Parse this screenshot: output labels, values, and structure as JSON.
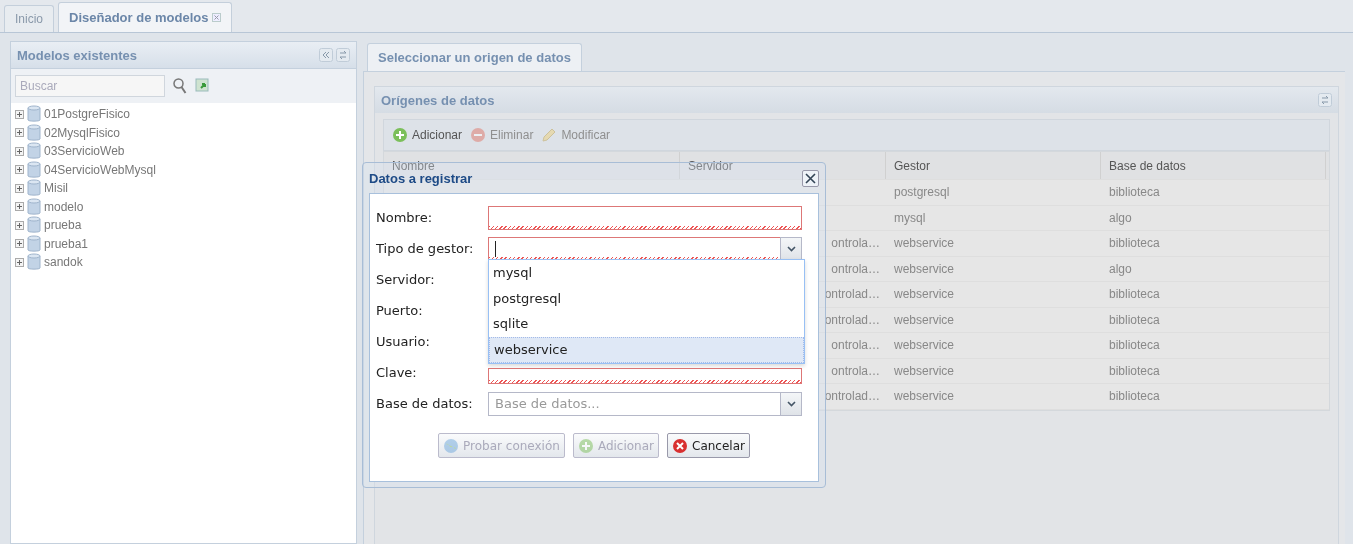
{
  "top_tabs": [
    {
      "label": "Inicio",
      "selected": false,
      "closable": false
    },
    {
      "label": "Diseñador de modelos",
      "selected": true,
      "closable": true
    }
  ],
  "left_panel": {
    "title": "Modelos existentes",
    "search": {
      "placeholder": "Buscar"
    },
    "tree": [
      {
        "label": "01PostgreFisico",
        "expanded": false
      },
      {
        "label": "02MysqlFisico",
        "expanded": false
      },
      {
        "label": "03ServicioWeb",
        "expanded": false
      },
      {
        "label": "04ServicioWebMysql",
        "expanded": false
      },
      {
        "label": "Misil",
        "expanded": false
      },
      {
        "label": "modelo",
        "expanded": false
      },
      {
        "label": "prueba",
        "expanded": false
      },
      {
        "label": "prueba1",
        "expanded": false
      },
      {
        "label": "sandok",
        "expanded": false
      }
    ]
  },
  "right_tabs": [
    {
      "label": "Seleccionar un origen de datos",
      "selected": true
    }
  ],
  "sources_panel": {
    "title": "Orígenes de datos",
    "toolbar": [
      {
        "label": "Adicionar",
        "kind": "add",
        "disabled": false
      },
      {
        "label": "Eliminar",
        "kind": "remove",
        "disabled": true
      },
      {
        "label": "Modificar",
        "kind": "edit",
        "disabled": true
      }
    ],
    "columns": [
      "Nombre",
      "Servidor",
      "Gestor",
      "Base de datos"
    ],
    "rows": [
      {
        "servidor": "",
        "gestor": "postgresql",
        "base": "biblioteca"
      },
      {
        "servidor": "",
        "gestor": "mysql",
        "base": "algo"
      },
      {
        "servidor": "ontrola…",
        "gestor": "webservice",
        "base": "biblioteca"
      },
      {
        "servidor": "ontrola…",
        "gestor": "webservice",
        "base": "algo"
      },
      {
        "servidor": "ontrolad…",
        "gestor": "webservice",
        "base": "biblioteca"
      },
      {
        "servidor": "ontrolad…",
        "gestor": "webservice",
        "base": "biblioteca"
      },
      {
        "servidor": "ontrola…",
        "gestor": "webservice",
        "base": "biblioteca"
      },
      {
        "servidor": "ontrola…",
        "gestor": "webservice",
        "base": "biblioteca"
      },
      {
        "servidor": "ontrolad…",
        "gestor": "webservice",
        "base": "biblioteca"
      }
    ]
  },
  "dialog": {
    "title": "Datos a registrar",
    "fields": [
      {
        "label": "Nombre:",
        "kind": "text",
        "invalid": true
      },
      {
        "label": "Tipo de gestor:",
        "kind": "combo",
        "invalid": true,
        "focused": true
      },
      {
        "label": "Servidor:",
        "kind": "covered"
      },
      {
        "label": "Puerto:",
        "kind": "covered"
      },
      {
        "label": "Usuario:",
        "kind": "covered"
      },
      {
        "label": "Clave:",
        "kind": "partial",
        "invalid": true
      },
      {
        "label": "Base de datos:",
        "kind": "combo",
        "invalid": false,
        "placeholder": "Base de datos..."
      }
    ],
    "dropdown": [
      {
        "label": "mysql",
        "selected": false
      },
      {
        "label": "postgresql",
        "selected": false
      },
      {
        "label": "sqlite",
        "selected": false
      },
      {
        "label": "webservice",
        "selected": true
      }
    ],
    "buttons": [
      {
        "label": "Probar conexión",
        "kind": "test",
        "disabled": true
      },
      {
        "label": "Adicionar",
        "kind": "add",
        "disabled": true
      },
      {
        "label": "Cancelar",
        "kind": "cancel",
        "disabled": false
      }
    ]
  }
}
